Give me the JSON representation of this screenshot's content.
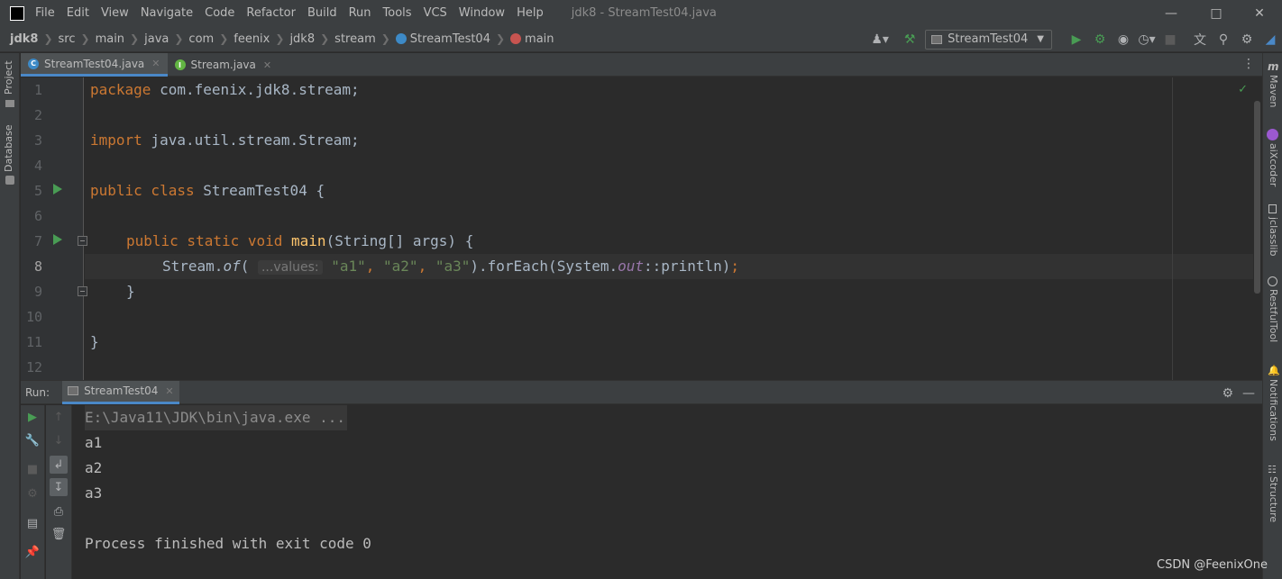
{
  "titlebar": {
    "logo": "IJ",
    "menu": [
      "File",
      "Edit",
      "View",
      "Navigate",
      "Code",
      "Refactor",
      "Build",
      "Run",
      "Tools",
      "VCS",
      "Window",
      "Help"
    ],
    "window_title": "jdk8 - StreamTest04.java"
  },
  "navbar": {
    "breadcrumbs": [
      "jdk8",
      "src",
      "main",
      "java",
      "com",
      "feenix",
      "jdk8",
      "stream",
      "StreamTest04",
      "main"
    ],
    "run_config": "StreamTest04"
  },
  "left_stripe": {
    "project": "Project",
    "database": "Database"
  },
  "right_stripe": {
    "maven": "Maven",
    "aixcoder": "aiXcoder",
    "jclasslib": "jclasslib",
    "restfultool": "RestfulTool",
    "notifications": "Notifications",
    "structure": "Structure"
  },
  "editor_tabs": [
    {
      "label": "StreamTest04.java",
      "color": "#3d8ac7",
      "letter": "C"
    },
    {
      "label": "Stream.java",
      "color": "#62b543",
      "letter": "I"
    }
  ],
  "editor": {
    "line_numbers": [
      "1",
      "2",
      "3",
      "4",
      "5",
      "6",
      "7",
      "8",
      "9",
      "10",
      "11",
      "12"
    ],
    "current_line": "8",
    "code": {
      "l1_kw": "package",
      "l1_rest": " com.feenix.jdk8.stream;",
      "l3_kw": "import",
      "l3_rest": " java.util.stream.Stream;",
      "l5_kw": "public class",
      "l5_rest": " StreamTest04 {",
      "l7_kw": "public static void",
      "l7_fn": "main",
      "l7_rest": "(String[] args) {",
      "l8_a": "Stream.",
      "l8_of": "of",
      "l8_b": "(",
      "l8_hint": "...values:",
      "l8_s1": "\"a1\"",
      "l8_c1": ", ",
      "l8_s2": "\"a2\"",
      "l8_c2": ", ",
      "l8_s3": "\"a3\"",
      "l8_d": ").forEach(System.",
      "l8_out": "out",
      "l8_e": "::println)",
      "l8_semi": ";",
      "l9": "}",
      "l11": "}"
    }
  },
  "run_panel": {
    "label": "Run:",
    "tab": "StreamTest04",
    "console": [
      "E:\\Java11\\JDK\\bin\\java.exe ...",
      "a1",
      "a2",
      "a3",
      "",
      "Process finished with exit code 0"
    ]
  },
  "watermark": "CSDN @FeenixOne",
  "colors": {
    "keyword": "#cc7832",
    "string": "#6a8759",
    "function": "#ffc66d",
    "static_field": "#9876aa",
    "accent": "#4a88c7",
    "run_green": "#499c54"
  }
}
